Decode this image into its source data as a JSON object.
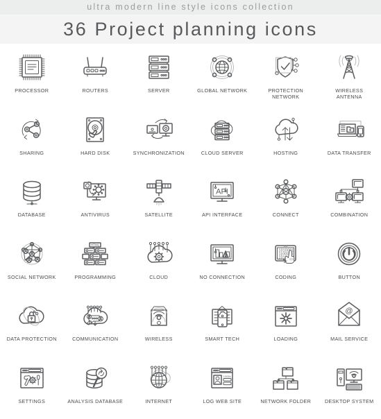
{
  "header": {
    "subtitle": "ultra modern line style icons collection",
    "title": "36 Project planning icons"
  },
  "colors": {
    "stroke": "#5b5c5e",
    "label": "#4a4b4d",
    "subtitle": "#9a9c9e",
    "title": "#58595b",
    "band_top": "#eceded",
    "band_title": "#f4f4f4",
    "background": "#ffffff"
  },
  "icon_inline_text": {
    "programming_tag": "HTML",
    "api_label": "API",
    "coding_bits": [
      "1010001",
      "1100001",
      "1010"
    ],
    "mail_symbol": "@",
    "login_label": "LOGIN"
  },
  "icons": [
    {
      "label": "PROCESSOR",
      "icon": "processor-icon"
    },
    {
      "label": "ROUTERS",
      "icon": "router-icon"
    },
    {
      "label": "SERVER",
      "icon": "server-rack-icon"
    },
    {
      "label": "GLOBAL NETWORK",
      "icon": "global-network-icon"
    },
    {
      "label": "PROTECTION\nNETWORK",
      "icon": "shield-check-network-icon"
    },
    {
      "label": "WIRELESS\nANTENNA",
      "icon": "antenna-tower-icon"
    },
    {
      "label": "SHARING",
      "icon": "sharing-icon"
    },
    {
      "label": "HARD DISK",
      "icon": "hard-disk-icon"
    },
    {
      "label": "SYNCHRONIZATION",
      "icon": "sync-monitors-icon"
    },
    {
      "label": "CLOUD SERVER",
      "icon": "cloud-server-icon"
    },
    {
      "label": "HOSTING",
      "icon": "hosting-cloud-arrows-icon"
    },
    {
      "label": "DATA TRANSFER",
      "icon": "data-transfer-icon"
    },
    {
      "label": "DATABASE",
      "icon": "database-icon"
    },
    {
      "label": "ANTIVIRUS",
      "icon": "antivirus-icon"
    },
    {
      "label": "SATELLITE",
      "icon": "satellite-icon"
    },
    {
      "label": "API INTERFACE",
      "icon": "api-interface-icon"
    },
    {
      "label": "CONNECT",
      "icon": "connect-nodes-icon"
    },
    {
      "label": "COMBINATION",
      "icon": "combination-monitors-icon"
    },
    {
      "label": "SOCIAL NETWORK",
      "icon": "social-network-icon"
    },
    {
      "label": "PROGRAMMING",
      "icon": "programming-icon"
    },
    {
      "label": "CLOUD",
      "icon": "cloud-gear-icon"
    },
    {
      "label": "NO CONNECTION",
      "icon": "no-connection-icon"
    },
    {
      "label": "CODING",
      "icon": "coding-icon"
    },
    {
      "label": "BUTTON",
      "icon": "power-button-icon"
    },
    {
      "label": "DATA PROTECTION",
      "icon": "data-protection-icon"
    },
    {
      "label": "COMMUNICATION",
      "icon": "communication-cloud-icon"
    },
    {
      "label": "WIRELESS",
      "icon": "wireless-box-icon"
    },
    {
      "label": "SMART TECH",
      "icon": "smart-tech-icon"
    },
    {
      "label": "LOADING",
      "icon": "loading-browser-icon"
    },
    {
      "label": "MAIL SERVICE",
      "icon": "mail-envelope-icon"
    },
    {
      "label": "SETTINGS",
      "icon": "settings-tools-icon"
    },
    {
      "label": "ANALYSIS DATABASE",
      "icon": "analysis-database-icon"
    },
    {
      "label": "INTERNET",
      "icon": "internet-globe-cloud-icon"
    },
    {
      "label": "LOG WEB SITE",
      "icon": "log-web-site-icon"
    },
    {
      "label": "NETWORK FOLDER",
      "icon": "network-folder-icon"
    },
    {
      "label": "DESKTOP SYSTEM",
      "icon": "desktop-system-icon"
    }
  ]
}
